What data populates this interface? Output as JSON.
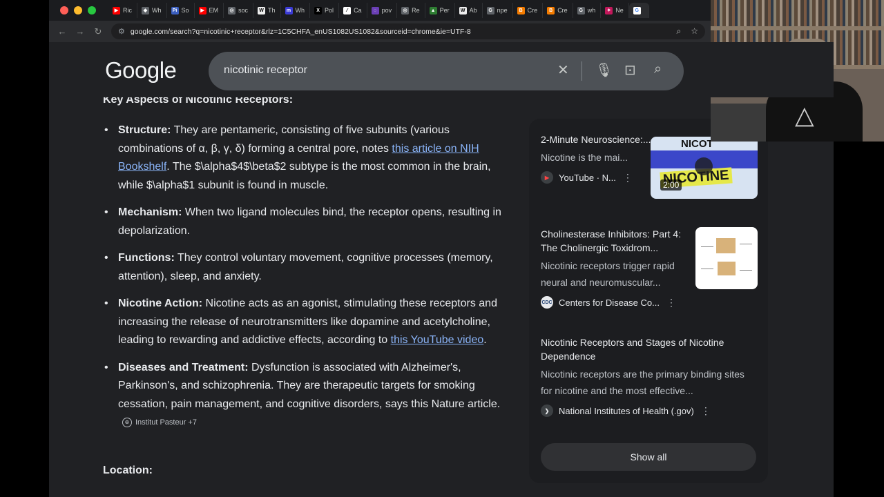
{
  "tabs": [
    {
      "label": "Ric",
      "fav": "youtube-favicon",
      "color": "#ff0000",
      "glyph": "▶"
    },
    {
      "label": "Wh",
      "fav": "shield-favicon",
      "color": "#5f6368",
      "glyph": "◆"
    },
    {
      "label": "So",
      "fav": "pi-favicon",
      "color": "#3b5fc0",
      "glyph": "Pi"
    },
    {
      "label": "EM",
      "fav": "youtube-favicon",
      "color": "#ff0000",
      "glyph": "▶"
    },
    {
      "label": "soc",
      "fav": "search-favicon",
      "color": "#5f6368",
      "glyph": "◎"
    },
    {
      "label": "Th",
      "fav": "wikipedia-favicon",
      "color": "#eeeeee",
      "glyph": "W"
    },
    {
      "label": "Wh",
      "fav": "m-favicon",
      "color": "#3b3bd6",
      "glyph": "m"
    },
    {
      "label": "Pol",
      "fav": "x-favicon",
      "color": "#000000",
      "glyph": "X"
    },
    {
      "label": "Ca",
      "fav": "doc-favicon",
      "color": "#ffffff",
      "glyph": "⁄"
    },
    {
      "label": "pov",
      "fav": "pov-favicon",
      "color": "#6a3fb5",
      "glyph": "◌"
    },
    {
      "label": "Re",
      "fav": "re-favicon",
      "color": "#5f6368",
      "glyph": "◎"
    },
    {
      "label": "Per",
      "fav": "lock-favicon",
      "color": "#2e7d32",
      "glyph": "▲"
    },
    {
      "label": "Ab",
      "fav": "wikipedia-favicon",
      "color": "#eeeeee",
      "glyph": "W"
    },
    {
      "label": "npe",
      "fav": "google-favicon",
      "color": "#5f6368",
      "glyph": "G"
    },
    {
      "label": "Cre",
      "fav": "blogger-favicon",
      "color": "#f57c00",
      "glyph": "B"
    },
    {
      "label": "Cre",
      "fav": "blogger-favicon",
      "color": "#f57c00",
      "glyph": "B"
    },
    {
      "label": "wh",
      "fav": "google-favicon",
      "color": "#5f6368",
      "glyph": "G"
    },
    {
      "label": "Ne",
      "fav": "star-favicon",
      "color": "#c2185b",
      "glyph": "✦"
    }
  ],
  "address": {
    "url": "google.com/search?q=nicotinic+receptor&rlz=1C5CHFA_enUS1082US1082&sourceid=chrome&ie=UTF-8"
  },
  "google": {
    "logo": "Google",
    "query": "nicotinic receptor"
  },
  "overview": {
    "heading": "Key Aspects of Nicotinic Receptors:",
    "items": [
      {
        "title": "Structure:",
        "text1": " They are pentameric, consisting of five subunits (various combinations of α, β, γ, δ) forming a central pore, notes ",
        "link": "this article on NIH Bookshelf",
        "text2": ". The $\\alpha$4$\\beta$2 subtype is the most common in the brain, while $\\alpha$1 subunit is found in muscle."
      },
      {
        "title": "Mechanism:",
        "text1": " When two ligand molecules bind, the receptor opens, resulting in depolarization."
      },
      {
        "title": "Functions:",
        "text1": " They control voluntary movement, cognitive processes (memory, attention), sleep, and anxiety."
      },
      {
        "title": "Nicotine Action:",
        "text1": " Nicotine acts as an agonist, stimulating these receptors and increasing the release of neurotransmitters like dopamine and acetylcholine, leading to rewarding and addictive effects, according to ",
        "link": "this YouTube video",
        "text2": "."
      },
      {
        "title": "Diseases and Treatment:",
        "text1": " Dysfunction is associated with Alzheimer's, Parkinson's, and schizophrenia. They are therapeutic targets for smoking cessation, pain management, and cognitive disorders, says this Nature article.",
        "chip": "Institut Pasteur +7"
      }
    ],
    "location_heading": "Location:"
  },
  "sources": [
    {
      "title": "2-Minute Neuroscience:...",
      "snippet": "Nicotine is the mai...",
      "source": "YouTube · N...",
      "thumb_duration": "2:00",
      "thumb_text1": "NICOT",
      "thumb_text2": "NICOTINE"
    },
    {
      "title": "Cholinesterase Inhibitors: Part 4: The Cholinergic Toxidrom...",
      "snippet": "Nicotinic receptors trigger rapid neural and neuromuscular...",
      "source": "Centers for Disease Co..."
    },
    {
      "title": "Nicotinic Receptors and Stages of Nicotine Dependence",
      "snippet": "Nicotinic receptors are the primary binding sites for nicotine and the most effective...",
      "source": "National Institutes of Health (.gov)"
    }
  ],
  "show_all": "Show all",
  "colors": {
    "background": "#202124",
    "link": "#8ab4f8",
    "searchbox": "#4d5156",
    "panel": "#1c1d20"
  }
}
